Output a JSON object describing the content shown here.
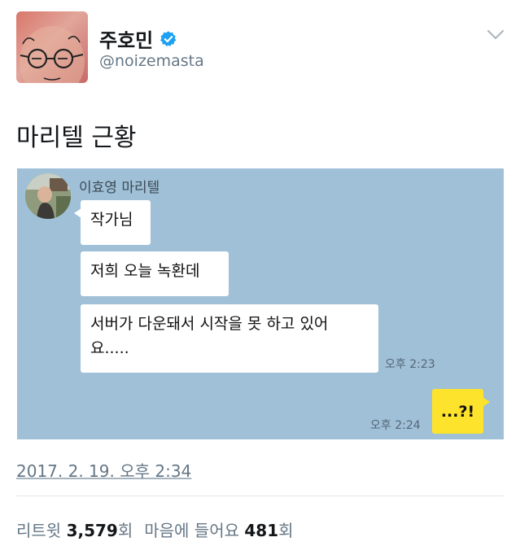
{
  "profile": {
    "display_name": "주호민",
    "handle": "@noizemasta",
    "verified": true,
    "verified_color": "#1da1f2"
  },
  "tweet": {
    "text": "마리텔 근황"
  },
  "chat": {
    "sender_name": "이효영 마리텔",
    "messages": [
      {
        "text": "작가님"
      },
      {
        "text": "저희 오늘 녹환데"
      },
      {
        "text": "서버가 다운돼서 시작을 못 하고 있어\n요....."
      }
    ],
    "incoming_time": "오후 2:23",
    "reply": {
      "text": "...?!",
      "time": "오후 2:24"
    },
    "background_color": "#9fc0d7",
    "reply_color": "#fde32c"
  },
  "meta": {
    "timestamp": "2017. 2. 19. 오후 2:34",
    "retweet_label": "리트윗",
    "retweet_count": "3,579",
    "retweet_unit": "회",
    "like_label": "마음에 들어요",
    "like_count": "481",
    "like_unit": "회"
  }
}
